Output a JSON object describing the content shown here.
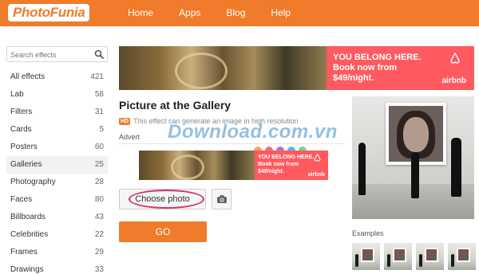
{
  "header": {
    "logo": "PhotoFunia",
    "nav": [
      "Home",
      "Apps",
      "Blog",
      "Help"
    ],
    "accent": "#f07b2a"
  },
  "sidebar": {
    "search_placeholder": "Search effects",
    "categories": [
      {
        "label": "All effects",
        "count": "421"
      },
      {
        "label": "Lab",
        "count": "58"
      },
      {
        "label": "Filters",
        "count": "31"
      },
      {
        "label": "Cards",
        "count": "5"
      },
      {
        "label": "Posters",
        "count": "60"
      },
      {
        "label": "Galleries",
        "count": "25"
      },
      {
        "label": "Photography",
        "count": "28"
      },
      {
        "label": "Faces",
        "count": "80"
      },
      {
        "label": "Billboards",
        "count": "43"
      },
      {
        "label": "Celebrities",
        "count": "22"
      },
      {
        "label": "Frames",
        "count": "29"
      },
      {
        "label": "Drawings",
        "count": "33"
      }
    ]
  },
  "ad": {
    "line1": "YOU BELONG HERE.",
    "line2": "Book now from",
    "line3": "$49/night.",
    "brand": "airbnb"
  },
  "main": {
    "title": "Picture at the Gallery",
    "hd_badge": "HD",
    "hd_text": "This effect can generate an image in high resolution",
    "advert_label": "Advert",
    "choose_label": "Choose photo",
    "go_label": "GO",
    "watermark": "Download.com.vn"
  },
  "right": {
    "examples_label": "Examples"
  }
}
